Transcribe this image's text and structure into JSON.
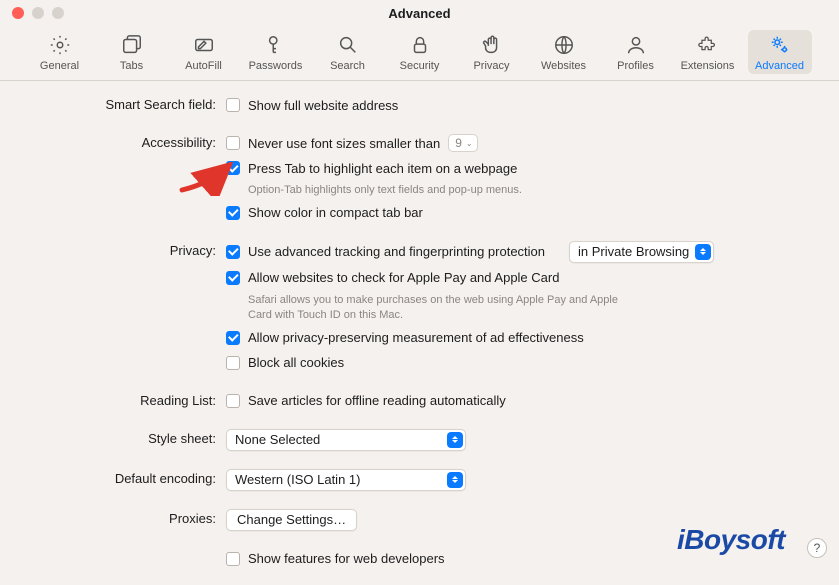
{
  "window": {
    "title": "Advanced"
  },
  "toolbar": {
    "items": [
      {
        "id": "general",
        "label": "General"
      },
      {
        "id": "tabs",
        "label": "Tabs"
      },
      {
        "id": "autofill",
        "label": "AutoFill"
      },
      {
        "id": "passwords",
        "label": "Passwords"
      },
      {
        "id": "search",
        "label": "Search"
      },
      {
        "id": "security",
        "label": "Security"
      },
      {
        "id": "privacy",
        "label": "Privacy"
      },
      {
        "id": "websites",
        "label": "Websites"
      },
      {
        "id": "profiles",
        "label": "Profiles"
      },
      {
        "id": "extensions",
        "label": "Extensions"
      },
      {
        "id": "advanced",
        "label": "Advanced",
        "active": true
      }
    ]
  },
  "sections": {
    "smart_search": {
      "label": "Smart Search field:",
      "show_full_url": {
        "text": "Show full website address",
        "checked": false
      }
    },
    "accessibility": {
      "label": "Accessibility:",
      "font_size_min": {
        "text": "Never use font sizes smaller than",
        "checked": false,
        "value": "9"
      },
      "tab_highlight": {
        "text": "Press Tab to highlight each item on a webpage",
        "checked": true,
        "hint": "Option-Tab highlights only text fields and pop-up menus."
      },
      "compact_color": {
        "text": "Show color in compact tab bar",
        "checked": true
      }
    },
    "privacy": {
      "label": "Privacy:",
      "tracking": {
        "text": "Use advanced tracking and fingerprinting protection",
        "checked": true,
        "scope": "in Private Browsing"
      },
      "apple_pay": {
        "text": "Allow websites to check for Apple Pay and Apple Card",
        "checked": true,
        "hint": "Safari allows you to make purchases on the web using Apple Pay and Apple Card with Touch ID on this Mac."
      },
      "ad_measure": {
        "text": "Allow privacy-preserving measurement of ad effectiveness",
        "checked": true
      },
      "block_cookies": {
        "text": "Block all cookies",
        "checked": false
      }
    },
    "reading_list": {
      "label": "Reading List:",
      "offline": {
        "text": "Save articles for offline reading automatically",
        "checked": false
      }
    },
    "style_sheet": {
      "label": "Style sheet:",
      "value": "None Selected"
    },
    "default_encoding": {
      "label": "Default encoding:",
      "value": "Western (ISO Latin 1)"
    },
    "proxies": {
      "label": "Proxies:",
      "button": "Change Settings…"
    },
    "dev": {
      "text": "Show features for web developers",
      "checked": false
    }
  },
  "watermark": "iBoysoft",
  "help": "?"
}
